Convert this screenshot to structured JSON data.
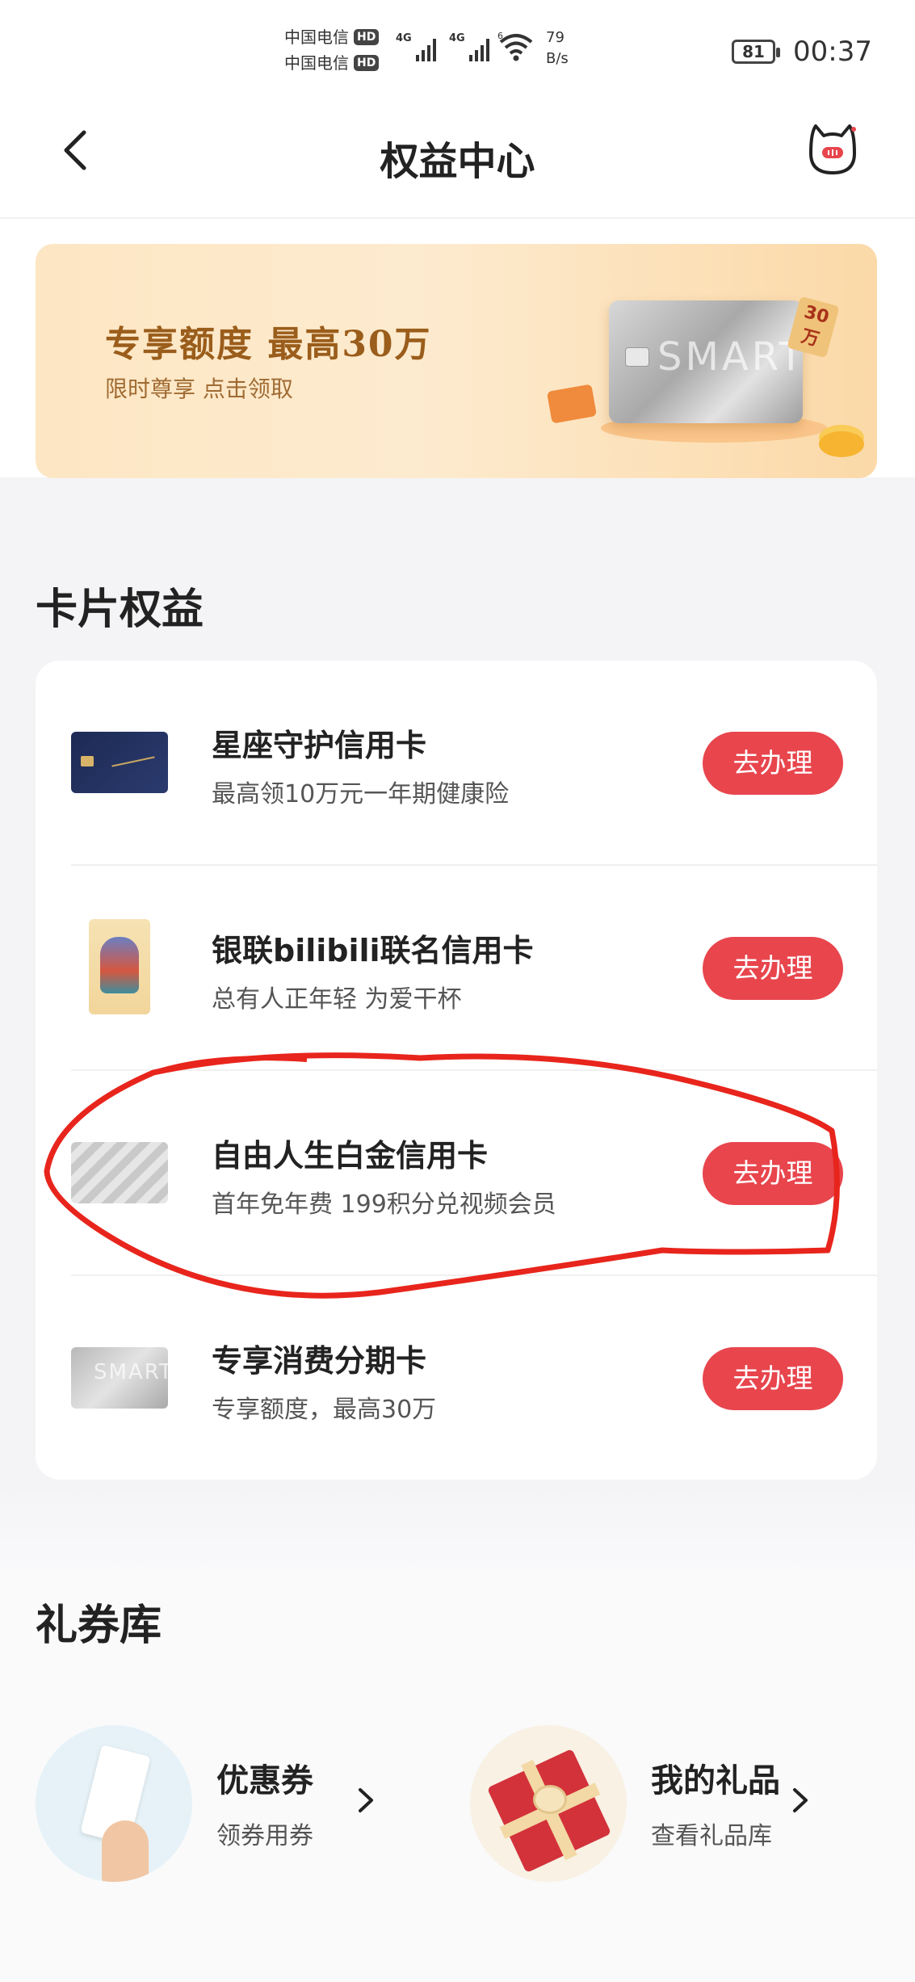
{
  "status_bar": {
    "carrier1": "中国电信",
    "carrier2": "中国电信",
    "hd_label": "HD",
    "net1": "4G",
    "net2": "4G",
    "wifi_tag": "6",
    "speed_value": "79",
    "speed_unit": "B/s",
    "battery": "81",
    "time": "00:37"
  },
  "nav": {
    "title": "权益中心",
    "back_icon": "chevron-left-icon",
    "mascot_icon": "cat-mascot-icon"
  },
  "banner": {
    "title": "专享额度 最高30万",
    "subtitle": "限时尊享 点击领取",
    "card_text": "SMART",
    "tag_line1": "30",
    "tag_line2": "万"
  },
  "card_section": {
    "title": "卡片权益",
    "button_label": "去办理",
    "items": [
      {
        "name": "星座守护信用卡",
        "desc": "最高领10万元一年期健康险"
      },
      {
        "name": "银联bilibili联名信用卡",
        "desc": "总有人正年轻 为爱干杯"
      },
      {
        "name": "自由人生白金信用卡",
        "desc": "首年免年费 199积分兑视频会员"
      },
      {
        "name": "专享消费分期卡",
        "desc": "专享额度，最高30万"
      }
    ]
  },
  "coupon_section": {
    "title": "礼券库",
    "items": [
      {
        "title": "优惠券",
        "subtitle": "领券用券"
      },
      {
        "title": "我的礼品",
        "subtitle": "查看礼品库"
      }
    ]
  },
  "colors": {
    "accent": "#e8454d",
    "annotation": "#e8251c",
    "banner_text": "#9a5d1b"
  }
}
